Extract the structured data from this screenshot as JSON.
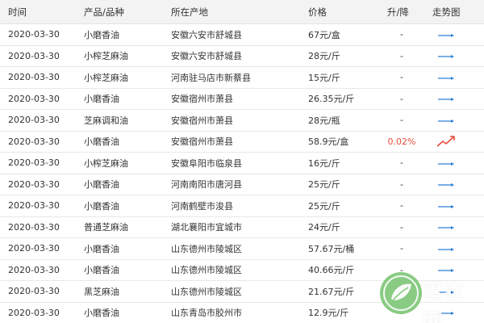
{
  "colors": {
    "header_bg": "#f3f3f3",
    "row_border": "#e8e8e8",
    "change_up": "#e74c3c",
    "trend_flat": "#2a7fd8",
    "trend_up": "#e74c3c",
    "logo_green": "#7cc576"
  },
  "table": {
    "headers": {
      "date": "时间",
      "product": "产品/品种",
      "place": "所在产地",
      "price": "价格",
      "change": "升/降",
      "trend": "走势图"
    },
    "rows": [
      {
        "date": "2020-03-30",
        "product": "小磨香油",
        "place": "安徽六安市舒城县",
        "price": "67元/盒",
        "change": "-",
        "trend": "flat-arrow-icon"
      },
      {
        "date": "2020-03-30",
        "product": "小榨芝麻油",
        "place": "安徽六安市舒城县",
        "price": "28元/斤",
        "change": "-",
        "trend": "flat-arrow-icon"
      },
      {
        "date": "2020-03-30",
        "product": "小榨芝麻油",
        "place": "河南驻马店市新蔡县",
        "price": "15元/斤",
        "change": "-",
        "trend": "flat-arrow-icon"
      },
      {
        "date": "2020-03-30",
        "product": "小磨香油",
        "place": "安徽宿州市萧县",
        "price": "26.35元/斤",
        "change": "-",
        "trend": "flat-arrow-icon"
      },
      {
        "date": "2020-03-30",
        "product": "芝麻调和油",
        "place": "安徽宿州市萧县",
        "price": "28元/瓶",
        "change": "-",
        "trend": "flat-arrow-icon"
      },
      {
        "date": "2020-03-30",
        "product": "小磨香油",
        "place": "安徽宿州市萧县",
        "price": "58.9元/盒",
        "change": "0.02%",
        "trend": "up-trend-icon"
      },
      {
        "date": "2020-03-30",
        "product": "小榨芝麻油",
        "place": "安徽阜阳市临泉县",
        "price": "16元/斤",
        "change": "-",
        "trend": "flat-arrow-icon"
      },
      {
        "date": "2020-03-30",
        "product": "小磨香油",
        "place": "河南南阳市唐河县",
        "price": "25元/斤",
        "change": "-",
        "trend": "flat-arrow-icon"
      },
      {
        "date": "2020-03-30",
        "product": "小磨香油",
        "place": "河南鹤壁市浚县",
        "price": "25元/斤",
        "change": "-",
        "trend": "flat-arrow-icon"
      },
      {
        "date": "2020-03-30",
        "product": "普通芝麻油",
        "place": "湖北襄阳市宜城市",
        "price": "24元/斤",
        "change": "-",
        "trend": "flat-arrow-icon"
      },
      {
        "date": "2020-03-30",
        "product": "小磨香油",
        "place": "山东德州市陵城区",
        "price": "57.67元/桶",
        "change": "-",
        "trend": "flat-arrow-icon"
      },
      {
        "date": "2020-03-30",
        "product": "小磨香油",
        "place": "山东德州市陵城区",
        "price": "40.66元/斤",
        "change": "-",
        "trend": "flat-arrow-icon"
      },
      {
        "date": "2020-03-30",
        "product": "黑芝麻油",
        "place": "山东德州市陵城区",
        "price": "21.67元/斤",
        "change": "-",
        "trend": "flat-arrow-icon"
      },
      {
        "date": "2020-03-30",
        "product": "小磨香油",
        "place": "山东青岛市胶州市",
        "price": "12.9元/斤",
        "change": "-",
        "trend": "flat-arrow-icon"
      }
    ]
  },
  "watermark": {
    "text": "惠农网",
    "subtext": "CNHNB.COM",
    "icon": "leaf-logo-icon"
  }
}
